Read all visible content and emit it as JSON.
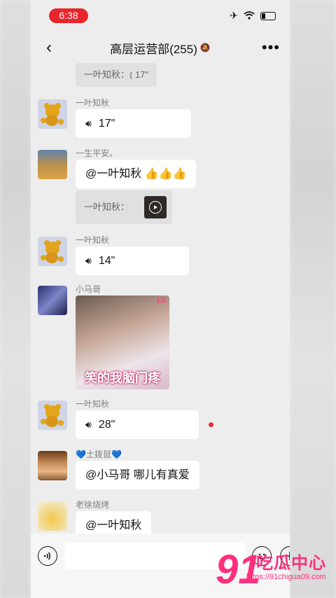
{
  "status_bar": {
    "time": "6:38",
    "icons": [
      "airplane-icon",
      "wifi-icon",
      "battery-icon"
    ]
  },
  "navbar": {
    "title": "高层运营部(255)",
    "back_icon": "chevron-left-icon",
    "mute_icon": "bell-off-icon",
    "more_icon": "more-horizontal-icon"
  },
  "messages": {
    "m0": {
      "quote": "一叶知秋：⦅ 17\""
    },
    "m1": {
      "name": "一叶知秋",
      "voice": "17\""
    },
    "m2": {
      "name": "一生平安。",
      "text": "@一叶知秋 👍👍👍",
      "quote": "一叶知秋："
    },
    "m3": {
      "name": "一叶知秋",
      "voice": "14\""
    },
    "m4": {
      "name": "小马哥",
      "sticker_caption": "笑的我脑门疼",
      "sticker_badge": "LC"
    },
    "m5": {
      "name": "一叶知秋",
      "voice": "28\""
    },
    "m6": {
      "name": "💙土拨鼠💙",
      "text": "@小马哥 哪儿有真爱"
    },
    "m7": {
      "name": "老徐烧烤",
      "text": "@一叶知秋"
    }
  },
  "input_bar": {
    "voice_icon": "voice-icon",
    "emoji_icon": "emoji-icon",
    "plus_icon": "plus-icon"
  },
  "watermark": {
    "big": "91",
    "text": "吃瓜中心",
    "url": "https://91chigua09.com"
  },
  "colors": {
    "accent": "#e9252c",
    "watermark": "#ff2f7d"
  }
}
